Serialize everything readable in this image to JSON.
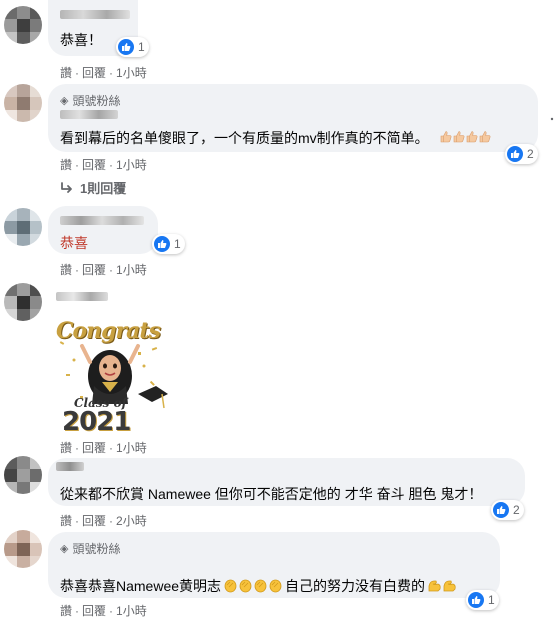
{
  "comments": [
    {
      "text": "恭喜！",
      "reactions": "1",
      "actions": {
        "like": "讚",
        "reply": "回覆",
        "time": "1小時"
      }
    },
    {
      "badge": "頭號粉絲",
      "text": "看到幕后的名单傻眼了，一个有质量的mv制作真的不简单。",
      "reactions": "2",
      "replies_label": "1則回覆"
    },
    {
      "text": "恭喜",
      "reactions": "1",
      "actions": {
        "like": "讚",
        "reply": "回覆",
        "time": "1小時"
      }
    },
    {
      "sticker": {
        "line1": "Congrats",
        "line2": "Class of",
        "line3": "2021"
      },
      "actions": {
        "like": "讚",
        "reply": "回覆",
        "time": "1小時"
      }
    },
    {
      "text": "從来都不欣賞 Namewee 但你可不能否定他的 才华 奋斗 胆色 鬼才！",
      "reactions": "2",
      "actions": {
        "like": "讚",
        "reply": "回覆",
        "time": "2小時"
      }
    },
    {
      "badge": "頭號粉絲",
      "text_a": "恭喜恭喜Namewee黄明志",
      "text_b": "自己的努力没有白费的",
      "reactions": "1",
      "actions": {
        "like": "讚",
        "reply": "回覆",
        "time": "1小時"
      }
    }
  ],
  "icons": {
    "like": "like-icon",
    "badge": "top-fan-diamond-icon",
    "reply_arrow": "reply-arrow-icon",
    "clap": "clapping-hands-emoji",
    "muscle": "flexed-biceps-emoji",
    "thumbs": "thumbs-up-emoji"
  },
  "colors": {
    "accent": "#1877f2",
    "bubble": "#f0f2f5",
    "secondary_text": "#65676b",
    "red_text": "#c0392b"
  }
}
